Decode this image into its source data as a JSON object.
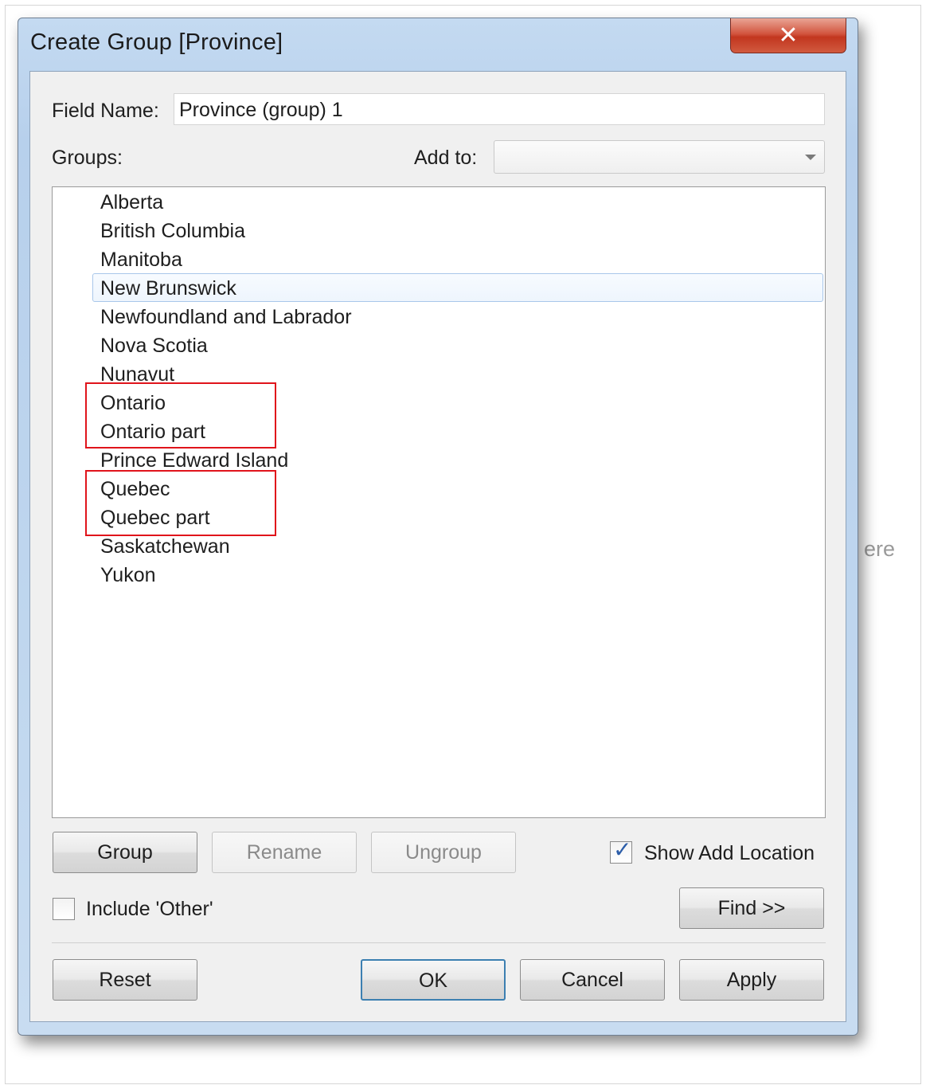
{
  "background": {
    "partial_text": "ere"
  },
  "dialog": {
    "title": "Create Group [Province]",
    "close_glyph": "✕",
    "field_name_label": "Field Name:",
    "field_name_value": "Province (group) 1",
    "groups_label": "Groups:",
    "add_to_label": "Add to:",
    "add_to_value": "",
    "list_items": [
      "Alberta",
      "British Columbia",
      "Manitoba",
      "New Brunswick",
      "Newfoundland and Labrador",
      "Nova Scotia",
      "Nunavut",
      "Ontario",
      "Ontario part",
      "Prince Edward Island",
      "Quebec",
      "Quebec part",
      "Saskatchewan",
      "Yukon"
    ],
    "focused_item": "New Brunswick",
    "highlighted_groups": [
      [
        "Ontario",
        "Ontario part"
      ],
      [
        "Quebec",
        "Quebec part"
      ]
    ],
    "buttons": {
      "group": "Group",
      "rename": "Rename",
      "ungroup": "Ungroup",
      "find": "Find >>",
      "reset": "Reset",
      "ok": "OK",
      "cancel": "Cancel",
      "apply": "Apply"
    },
    "show_add_location": {
      "label": "Show Add Location",
      "checked": true
    },
    "include_other": {
      "label": "Include 'Other'",
      "checked": false
    }
  }
}
